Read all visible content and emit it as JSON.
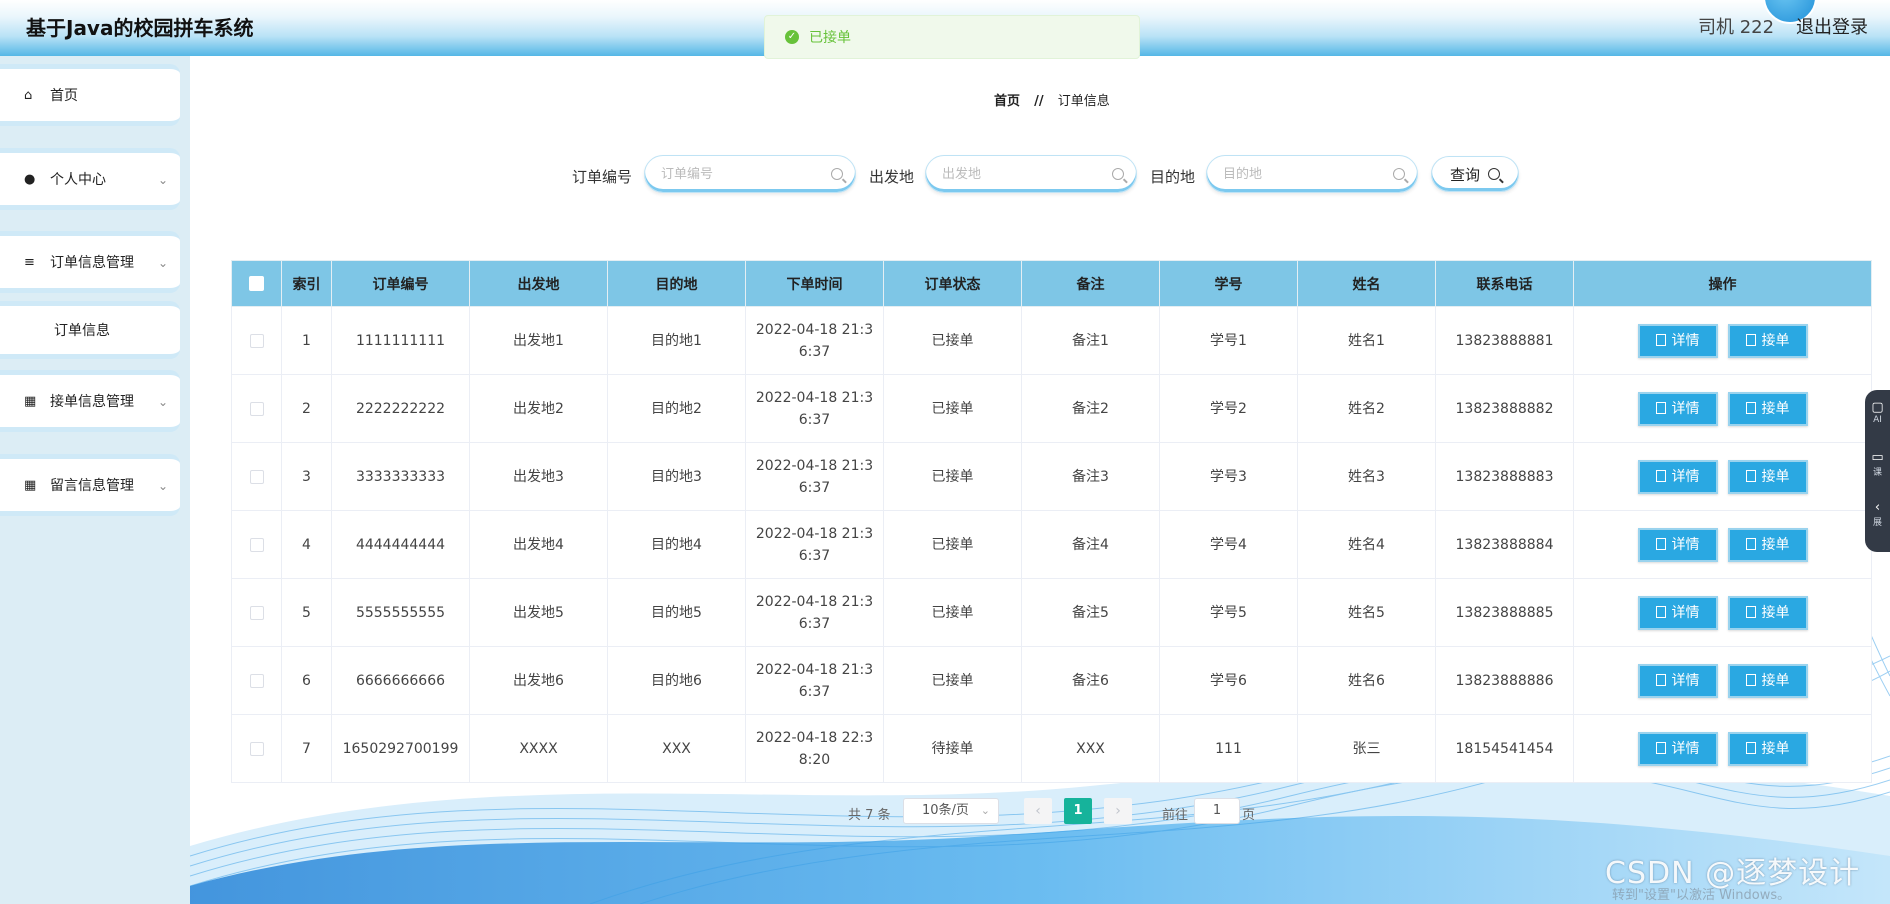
{
  "header": {
    "app_title": "基于Java的校园拼车系统",
    "user": "司机 222",
    "logout": "退出登录"
  },
  "toast": {
    "message": "已接单",
    "status_color": "#67c23a"
  },
  "sidebar": {
    "items": [
      {
        "label": "首页",
        "icon": "home-icon"
      },
      {
        "label": "个人中心",
        "icon": "user-icon"
      },
      {
        "label": "订单信息管理",
        "icon": "list-icon"
      },
      {
        "label": "订单信息",
        "icon": ""
      },
      {
        "label": "接单信息管理",
        "icon": "grid-icon"
      },
      {
        "label": "留言信息管理",
        "icon": "grid-icon"
      }
    ]
  },
  "breadcrumb": {
    "home": "首页",
    "sep": "//",
    "current": "订单信息"
  },
  "filters": {
    "order_no_label": "订单编号",
    "order_no_placeholder": "订单编号",
    "origin_label": "出发地",
    "origin_placeholder": "出发地",
    "dest_label": "目的地",
    "dest_placeholder": "目的地",
    "query_label": "查询"
  },
  "table": {
    "headers": [
      "索引",
      "订单编号",
      "出发地",
      "目的地",
      "下单时间",
      "订单状态",
      "备注",
      "学号",
      "姓名",
      "联系电话",
      "操作"
    ],
    "detail_label": "详情",
    "accept_label": "接单",
    "rows": [
      {
        "index": "1",
        "order_no": "1111111111",
        "origin": "出发地1",
        "dest": "目的地1",
        "time_a": "2022-04-18 21:3",
        "time_b": "6:37",
        "status": "已接单",
        "note": "备注1",
        "sid": "学号1",
        "name": "姓名1",
        "phone": "13823888881"
      },
      {
        "index": "2",
        "order_no": "2222222222",
        "origin": "出发地2",
        "dest": "目的地2",
        "time_a": "2022-04-18 21:3",
        "time_b": "6:37",
        "status": "已接单",
        "note": "备注2",
        "sid": "学号2",
        "name": "姓名2",
        "phone": "13823888882"
      },
      {
        "index": "3",
        "order_no": "3333333333",
        "origin": "出发地3",
        "dest": "目的地3",
        "time_a": "2022-04-18 21:3",
        "time_b": "6:37",
        "status": "已接单",
        "note": "备注3",
        "sid": "学号3",
        "name": "姓名3",
        "phone": "13823888883"
      },
      {
        "index": "4",
        "order_no": "4444444444",
        "origin": "出发地4",
        "dest": "目的地4",
        "time_a": "2022-04-18 21:3",
        "time_b": "6:37",
        "status": "已接单",
        "note": "备注4",
        "sid": "学号4",
        "name": "姓名4",
        "phone": "13823888884"
      },
      {
        "index": "5",
        "order_no": "5555555555",
        "origin": "出发地5",
        "dest": "目的地5",
        "time_a": "2022-04-18 21:3",
        "time_b": "6:37",
        "status": "已接单",
        "note": "备注5",
        "sid": "学号5",
        "name": "姓名5",
        "phone": "13823888885"
      },
      {
        "index": "6",
        "order_no": "6666666666",
        "origin": "出发地6",
        "dest": "目的地6",
        "time_a": "2022-04-18 21:3",
        "time_b": "6:37",
        "status": "已接单",
        "note": "备注6",
        "sid": "学号6",
        "name": "姓名6",
        "phone": "13823888886"
      },
      {
        "index": "7",
        "order_no": "1650292700199",
        "origin": "XXXX",
        "dest": "XXX",
        "time_a": "2022-04-18 22:3",
        "time_b": "8:20",
        "status": "待接单",
        "note": "XXX",
        "sid": "111",
        "name": "张三",
        "phone": "18154541454"
      }
    ]
  },
  "pagination": {
    "total": "共 7 条",
    "page_size": "10条/页",
    "current_page": "1",
    "goto_label": "前往",
    "goto_value": "1",
    "page_suffix": "页"
  },
  "float_panel": [
    {
      "label": "AI",
      "icon": "ai-icon"
    },
    {
      "label": "课",
      "icon": "course-icon"
    },
    {
      "label": "展",
      "icon": "collapse-icon"
    }
  ],
  "watermark": {
    "text": "CSDN @逐梦设计",
    "activate_text": "转到\"设置\"以激活 Windows。"
  },
  "colors": {
    "header_accent": "#55b7e6",
    "table_header": "#7ec6e6",
    "button": "#2aa8e2",
    "page_active": "#16b39b"
  }
}
